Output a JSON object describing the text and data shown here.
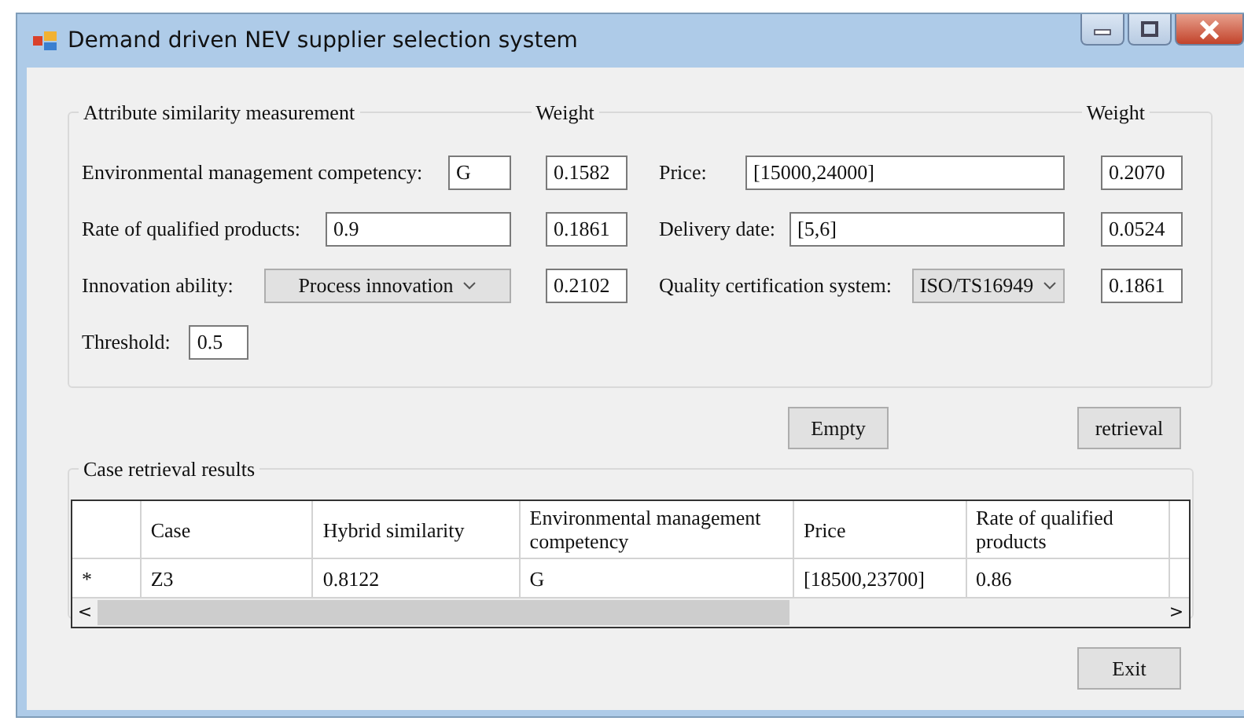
{
  "window": {
    "title": "Demand driven NEV supplier selection system"
  },
  "attributes": {
    "legend": "Attribute similarity measurement",
    "weight_headers": [
      "Weight",
      "Weight"
    ],
    "rows": [
      {
        "left": {
          "kind": "text",
          "label": "Environmental management competency:",
          "value": "G"
        },
        "left_weight": "0.1582",
        "right": {
          "kind": "text",
          "label": "Price:",
          "value": "[15000,24000]"
        },
        "right_weight": "0.2070"
      },
      {
        "left": {
          "kind": "text",
          "label": "Rate of qualified products:",
          "value": "0.9"
        },
        "left_weight": "0.1861",
        "right": {
          "kind": "text",
          "label": "Delivery date:",
          "value": "[5,6]"
        },
        "right_weight": "0.0524"
      },
      {
        "left": {
          "kind": "dropdown",
          "label": "Innovation ability:",
          "value": "Process innovation"
        },
        "left_weight": "0.2102",
        "right": {
          "kind": "dropdown",
          "label": "Quality certification system:",
          "value": "ISO/TS16949"
        },
        "right_weight": "0.1861"
      }
    ],
    "threshold": {
      "label": "Threshold:",
      "value": "0.5"
    }
  },
  "buttons": [
    "Empty",
    "retrieval"
  ],
  "results": {
    "legend": "Case retrieval results",
    "columns": [
      "Case",
      "Hybrid similarity",
      "Environmental management competency",
      "Price",
      "Rate of qualified products"
    ],
    "rows": [
      {
        "marker": "*",
        "cells": [
          "Z3",
          "0.8122",
          "G",
          "[18500,23700]",
          "0.86"
        ]
      }
    ],
    "scroll_left": "<",
    "scroll_right": ">"
  },
  "exit_button": "Exit"
}
